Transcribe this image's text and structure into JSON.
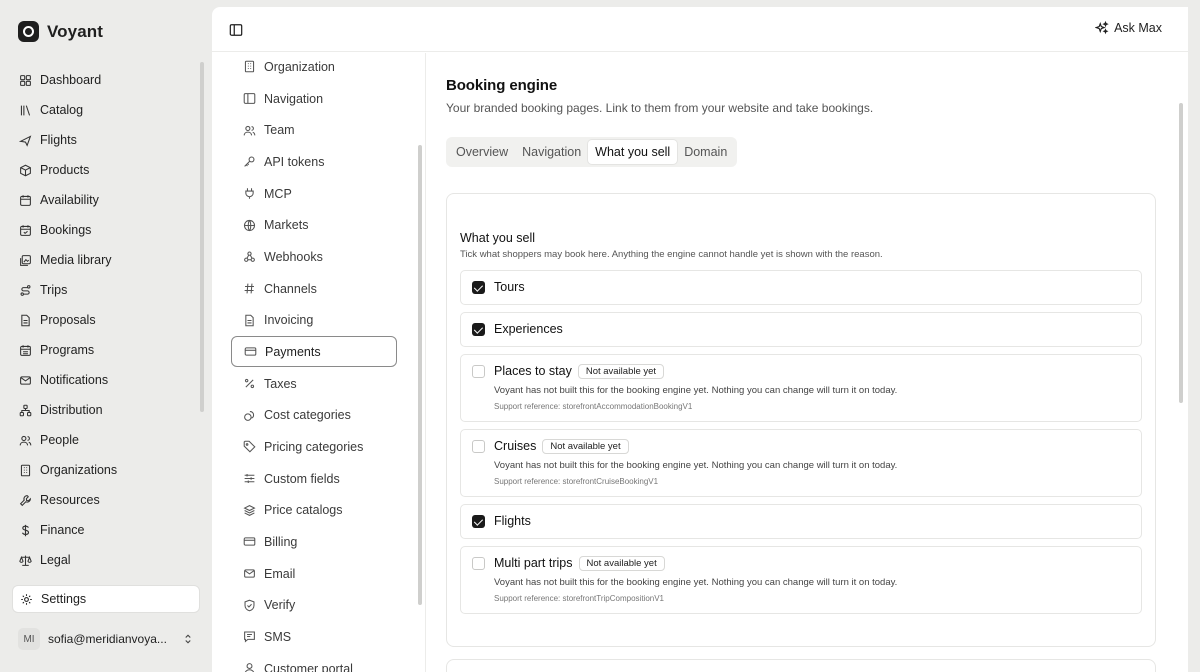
{
  "app": {
    "name": "Voyant"
  },
  "sidebar": {
    "items": [
      {
        "label": "Dashboard",
        "icon": "dashboard-icon"
      },
      {
        "label": "Catalog",
        "icon": "catalog-icon"
      },
      {
        "label": "Flights",
        "icon": "plane-icon"
      },
      {
        "label": "Products",
        "icon": "package-icon"
      },
      {
        "label": "Availability",
        "icon": "calendar-icon"
      },
      {
        "label": "Bookings",
        "icon": "calendar-check-icon"
      },
      {
        "label": "Media library",
        "icon": "image-icon"
      },
      {
        "label": "Trips",
        "icon": "route-icon"
      },
      {
        "label": "Proposals",
        "icon": "file-icon"
      },
      {
        "label": "Programs",
        "icon": "calendar-grid-icon"
      },
      {
        "label": "Notifications",
        "icon": "mail-icon"
      },
      {
        "label": "Distribution",
        "icon": "network-icon"
      },
      {
        "label": "People",
        "icon": "people-icon"
      },
      {
        "label": "Organizations",
        "icon": "building-icon"
      },
      {
        "label": "Resources",
        "icon": "wrench-icon"
      },
      {
        "label": "Finance",
        "icon": "dollar-icon"
      },
      {
        "label": "Legal",
        "icon": "scale-icon"
      }
    ],
    "settings": {
      "label": "Settings",
      "icon": "gear-icon"
    },
    "user": {
      "initials": "MI",
      "email": "sofia@meridianvoya..."
    }
  },
  "topbar": {
    "ask_label": "Ask Max"
  },
  "settings_nav": {
    "items": [
      {
        "label": "Organization",
        "icon": "building-icon"
      },
      {
        "label": "Navigation",
        "icon": "sidebar-icon"
      },
      {
        "label": "Team",
        "icon": "people-icon"
      },
      {
        "label": "API tokens",
        "icon": "key-icon"
      },
      {
        "label": "MCP",
        "icon": "plug-icon"
      },
      {
        "label": "Markets",
        "icon": "globe-icon"
      },
      {
        "label": "Webhooks",
        "icon": "webhook-icon"
      },
      {
        "label": "Channels",
        "icon": "hash-icon"
      },
      {
        "label": "Invoicing",
        "icon": "receipt-icon"
      },
      {
        "label": "Payments",
        "icon": "credit-card-icon",
        "active": true
      },
      {
        "label": "Taxes",
        "icon": "percent-icon"
      },
      {
        "label": "Cost categories",
        "icon": "coins-icon"
      },
      {
        "label": "Pricing categories",
        "icon": "tag-icon"
      },
      {
        "label": "Custom fields",
        "icon": "sliders-icon"
      },
      {
        "label": "Price catalogs",
        "icon": "layers-icon"
      },
      {
        "label": "Billing",
        "icon": "credit-card-icon"
      },
      {
        "label": "Email",
        "icon": "mail-icon"
      },
      {
        "label": "Verify",
        "icon": "shield-check-icon"
      },
      {
        "label": "SMS",
        "icon": "message-icon"
      },
      {
        "label": "Customer portal",
        "icon": "user-icon"
      }
    ]
  },
  "page": {
    "title": "Booking engine",
    "subtitle": "Your branded booking pages. Link to them from your website and take bookings.",
    "tabs": [
      "Overview",
      "Navigation",
      "What you sell",
      "Domain"
    ],
    "active_tab": "What you sell"
  },
  "section": {
    "title": "What you sell",
    "subtitle": "Tick what shoppers may book here. Anything the engine cannot handle yet is shown with the reason.",
    "items": [
      {
        "name": "Tours",
        "checked": true
      },
      {
        "name": "Experiences",
        "checked": true
      },
      {
        "name": "Places to stay",
        "checked": false,
        "badge": "Not available yet",
        "description": "Voyant has not built this for the booking engine yet. Nothing you can change will turn it on today.",
        "reference": "Support reference: storefrontAccommodationBookingV1"
      },
      {
        "name": "Cruises",
        "checked": false,
        "badge": "Not available yet",
        "description": "Voyant has not built this for the booking engine yet. Nothing you can change will turn it on today.",
        "reference": "Support reference: storefrontCruiseBookingV1"
      },
      {
        "name": "Flights",
        "checked": true
      },
      {
        "name": "Multi part trips",
        "checked": false,
        "badge": "Not available yet",
        "description": "Voyant has not built this for the booking engine yet. Nothing you can change will turn it on today.",
        "reference": "Support reference: storefrontTripCompositionV1"
      }
    ]
  }
}
